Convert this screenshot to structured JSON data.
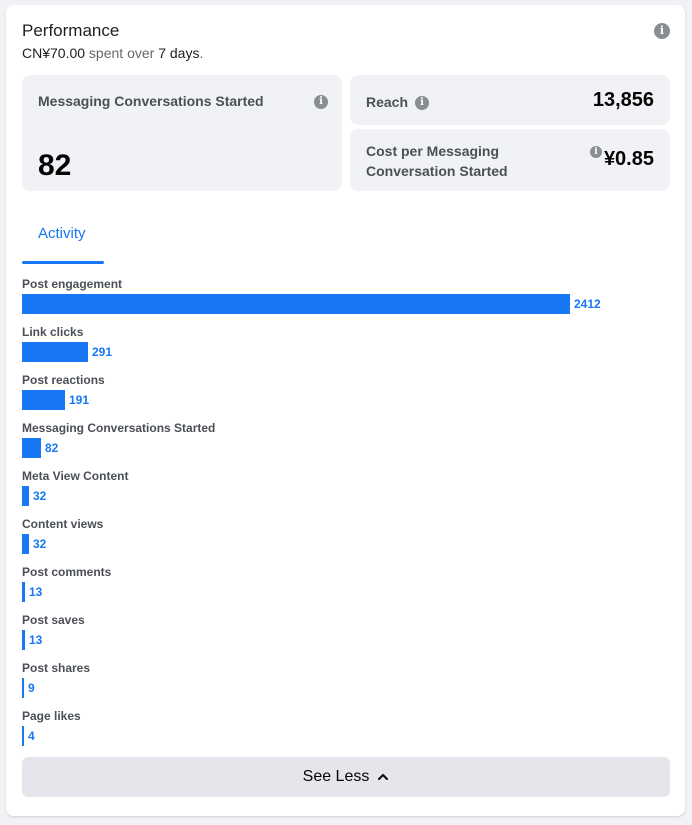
{
  "header": {
    "title": "Performance",
    "spent_amount": "CN¥70.00",
    "spent_mid": " spent over ",
    "spent_days": "7 days",
    "spent_end": ".",
    "info_icon": "info-icon"
  },
  "metrics": {
    "messaging": {
      "label": "Messaging Conversations Started",
      "value": "82"
    },
    "reach": {
      "label": "Reach",
      "value": "13,856"
    },
    "cost": {
      "label": "Cost per Messaging Conversation Started",
      "value": "¥0.85"
    }
  },
  "tabs": [
    {
      "label": "Activity",
      "active": true
    }
  ],
  "activity": [
    {
      "label": "Post engagement",
      "value": 2412
    },
    {
      "label": "Link clicks",
      "value": 291
    },
    {
      "label": "Post reactions",
      "value": 191
    },
    {
      "label": "Messaging Conversations Started",
      "value": 82
    },
    {
      "label": "Meta View Content",
      "value": 32
    },
    {
      "label": "Content views",
      "value": 32
    },
    {
      "label": "Post comments",
      "value": 13
    },
    {
      "label": "Post saves",
      "value": 13
    },
    {
      "label": "Post shares",
      "value": 9
    },
    {
      "label": "Page likes",
      "value": 4
    }
  ],
  "footer": {
    "see_less_label": "See Less",
    "chevron_icon": "chevron-up-icon"
  },
  "colors": {
    "accent": "#1877f2",
    "tile_bg": "#f0f2f5",
    "button_bg": "#e4e6eb"
  }
}
